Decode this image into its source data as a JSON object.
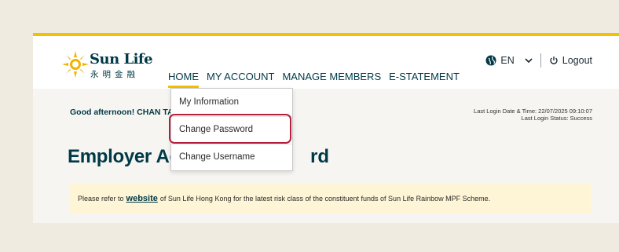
{
  "brand": {
    "name": "Sun Life",
    "chinese": "永明金融"
  },
  "nav": [
    {
      "label": "HOME",
      "active": true
    },
    {
      "label": "MY ACCOUNT",
      "active": false
    },
    {
      "label": "MANAGE MEMBERS",
      "active": false
    },
    {
      "label": "E-STATEMENT",
      "active": false
    }
  ],
  "topright": {
    "language": "EN",
    "logout": "Logout"
  },
  "greeting": "Good afternoon! CHAN TA",
  "login": {
    "date_line": "Last Login Date & Time: 22/07/2025 09:10:07",
    "status_line": "Last Login Status: Success"
  },
  "page": {
    "title_start": "Employer Ac",
    "title_end": "rd"
  },
  "notice": {
    "prefix": "Please refer to",
    "link": "website",
    "suffix": "of Sun Life Hong Kong for the latest risk class of the constituent funds of Sun Life Rainbow MPF Scheme."
  },
  "dropdown": {
    "items": [
      "My Information",
      "Change Password",
      "Change Username"
    ],
    "highlighted": "Change Password"
  },
  "colors": {
    "accent": "#f2c200",
    "brand_dark": "#003946",
    "highlight": "#b61f3a",
    "notice_bg": "#fdf5d6"
  }
}
